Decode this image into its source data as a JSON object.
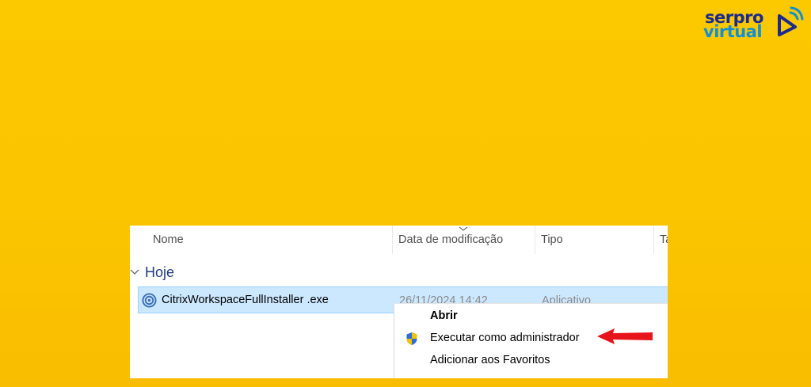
{
  "brand": {
    "line1": "serpro",
    "line2": "virtual",
    "colors": {
      "dark_blue": "#1b2a8f",
      "light_blue": "#0f8fd6",
      "background": "#fcc800"
    },
    "mark_icon": "play-signal-icon"
  },
  "explorer": {
    "columns": {
      "name": "Nome",
      "date": "Data de modificação",
      "type": "Tipo",
      "size": "Ta"
    },
    "sort_indicator_icon": "chevron-down-icon",
    "group": {
      "label": "Hoje",
      "icon": "chevron-down-icon"
    },
    "file": {
      "name": "CitrixWorkspaceFullInstaller .exe",
      "date": "26/11/2024 14:42",
      "type": "Aplicativo",
      "icon": "citrix-icon"
    }
  },
  "context_menu": {
    "items": [
      {
        "label": "Abrir",
        "bold": true
      },
      {
        "label": "Executar como administrador",
        "icon": "uac-shield-icon"
      },
      {
        "label": "Adicionar aos Favoritos"
      }
    ]
  },
  "annotation": {
    "icon": "red-arrow-icon",
    "color": "#e8141c"
  }
}
